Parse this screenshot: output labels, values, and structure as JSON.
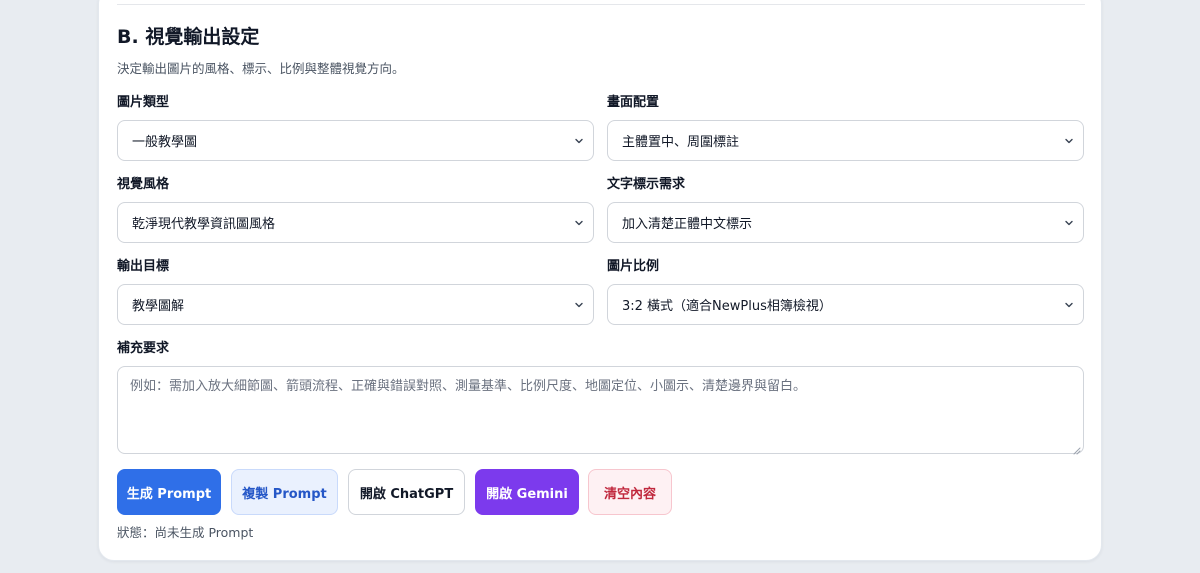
{
  "section": {
    "title": "B. 視覺輸出設定",
    "description": "決定輸出圖片的風格、標示、比例與整體視覺方向。"
  },
  "fields": {
    "image_type": {
      "label": "圖片類型",
      "value": "一般教學圖"
    },
    "layout": {
      "label": "畫面配置",
      "value": "主體置中、周圍標註"
    },
    "visual_style": {
      "label": "視覺風格",
      "value": "乾淨現代教學資訊圖風格"
    },
    "text_labels": {
      "label": "文字標示需求",
      "value": "加入清楚正體中文標示"
    },
    "output_goal": {
      "label": "輸出目標",
      "value": "教學圖解"
    },
    "aspect_ratio": {
      "label": "圖片比例",
      "value": "3:2 橫式（適合NewPlus相簿檢視）"
    }
  },
  "supplement": {
    "label": "補充要求",
    "placeholder": "例如：需加入放大細節圖、箭頭流程、正確與錯誤對照、測量基準、比例尺度、地圖定位、小圖示、清楚邊界與留白。"
  },
  "buttons": {
    "generate": "生成 Prompt",
    "copy": "複製 Prompt",
    "chatgpt": "開啟 ChatGPT",
    "gemini": "開啟 Gemini",
    "clear": "清空內容"
  },
  "status": "狀態：尚未生成 Prompt",
  "icons": {
    "select_arrow": "chevron-down-icon",
    "textarea_resize": "resize-grip-icon"
  },
  "colors": {
    "primary": "#2f6fe8",
    "gemini": "#7c3aed",
    "danger": "#c0283d",
    "background": "#e8ecf1"
  }
}
